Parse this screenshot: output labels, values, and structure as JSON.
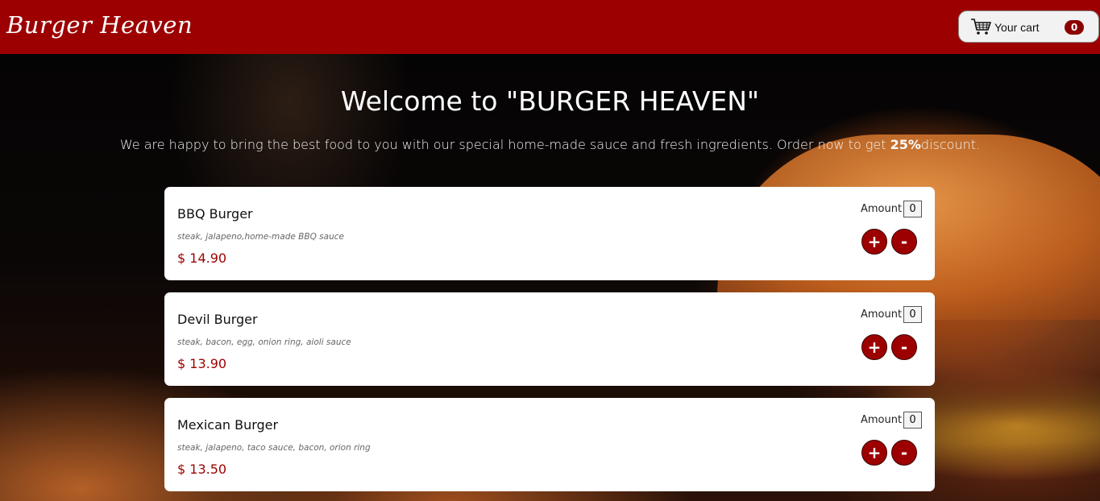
{
  "header": {
    "logo": "Burger Heaven",
    "cart_label": "Your cart",
    "cart_count": "0",
    "brand_color": "#9d0000"
  },
  "hero": {
    "welcome": "Welcome to \"BURGER HEAVEN\"",
    "intro_before": "We are happy to bring the best food to you with our special home-made sauce and fresh ingredients. Order now to get ",
    "intro_bold": "25%",
    "intro_after": "discount."
  },
  "menu": {
    "items": [
      {
        "name": "BBQ Burger",
        "description": "steak, jalapeno,home-made BBQ sauce",
        "price": "$ 14.90",
        "amount_label": "Amount",
        "amount": "0",
        "plus": "+",
        "minus": "-"
      },
      {
        "name": "Devil Burger",
        "description": "steak, bacon, egg, onion ring, aioli sauce",
        "price": "$ 13.90",
        "amount_label": "Amount",
        "amount": "0",
        "plus": "+",
        "minus": "-"
      },
      {
        "name": "Mexican Burger",
        "description": "steak, jalapeno, taco sauce, bacon, orion ring",
        "price": "$ 13.50",
        "amount_label": "Amount",
        "amount": "0",
        "plus": "+",
        "minus": "-"
      }
    ]
  },
  "icons": {
    "cart": "shopping-cart-icon"
  }
}
